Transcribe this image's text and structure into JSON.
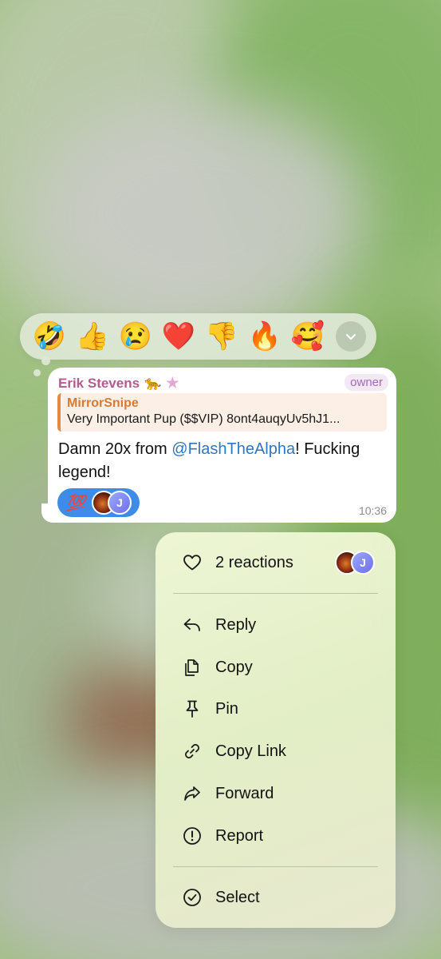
{
  "reactions_bar": {
    "emojis": [
      "🤣",
      "👍",
      "😢",
      "❤️",
      "👎",
      "🔥",
      "🥰"
    ],
    "more_icon": "chevron-down-icon"
  },
  "message": {
    "sender_name": "Erik Stevens",
    "sender_emoji": "🐆",
    "sender_star": "★",
    "role_tag": "owner",
    "quote": {
      "title": "MirrorSnipe",
      "text": "Very Important Pup ($$VIP) 8ont4auqyUv5hJ1..."
    },
    "text_before": "Damn 20x from ",
    "mention": "@FlashTheAlpha",
    "text_after": "! Fucking legend!",
    "reaction": {
      "emoji": "💯",
      "avatar_initial": "J"
    },
    "time": "10:36"
  },
  "menu": {
    "reactions_label": "2 reactions",
    "reactors_initial": "J",
    "items": [
      {
        "label": "Reply",
        "icon": "reply-icon"
      },
      {
        "label": "Copy",
        "icon": "copy-icon"
      },
      {
        "label": "Pin",
        "icon": "pin-icon"
      },
      {
        "label": "Copy Link",
        "icon": "link-icon"
      },
      {
        "label": "Forward",
        "icon": "forward-icon"
      },
      {
        "label": "Report",
        "icon": "report-icon"
      }
    ],
    "select_label": "Select"
  },
  "colors": {
    "sender": "#b45a8f",
    "quote_accent": "#e38b45",
    "mention": "#2f76c2",
    "reaction_pill": "#3d8de8"
  }
}
